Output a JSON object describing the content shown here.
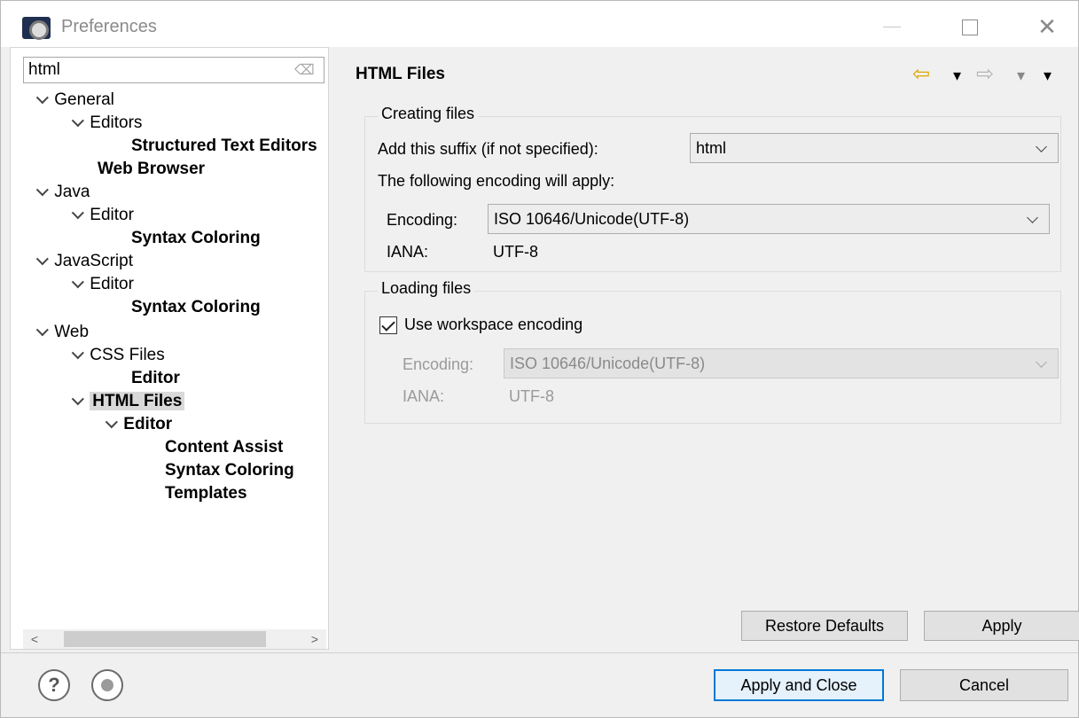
{
  "window": {
    "title": "Preferences",
    "close_glyph": "✕"
  },
  "sidebar": {
    "filter_value": "html",
    "items": [
      {
        "label": "General",
        "level": 0,
        "expanded": true,
        "bold": false
      },
      {
        "label": "Editors",
        "level": 1,
        "expanded": true,
        "bold": false
      },
      {
        "label": "Structured Text Editors",
        "level": 2,
        "expanded": false,
        "bold": true
      },
      {
        "label": "Web Browser",
        "level": 1,
        "expanded": false,
        "bold": true
      },
      {
        "label": "Java",
        "level": 0,
        "expanded": true,
        "bold": false
      },
      {
        "label": "Editor",
        "level": 1,
        "expanded": true,
        "bold": false
      },
      {
        "label": "Syntax Coloring",
        "level": 2,
        "expanded": false,
        "bold": true
      },
      {
        "label": "JavaScript",
        "level": 0,
        "expanded": true,
        "bold": false
      },
      {
        "label": "Editor",
        "level": 1,
        "expanded": true,
        "bold": false
      },
      {
        "label": "Syntax Coloring",
        "level": 2,
        "expanded": false,
        "bold": true
      },
      {
        "label": "Web",
        "level": 0,
        "expanded": true,
        "bold": false
      },
      {
        "label": "CSS Files",
        "level": 1,
        "expanded": true,
        "bold": false
      },
      {
        "label": "Editor",
        "level": 2,
        "expanded": false,
        "bold": true
      },
      {
        "label": "HTML Files",
        "level": 1,
        "expanded": true,
        "bold": true,
        "selected": true
      },
      {
        "label": "Editor",
        "level": 2,
        "expanded": true,
        "bold": true
      },
      {
        "label": "Content Assist",
        "level": 3,
        "expanded": false,
        "bold": true
      },
      {
        "label": "Syntax Coloring",
        "level": 3,
        "expanded": false,
        "bold": true
      },
      {
        "label": "Templates",
        "level": 3,
        "expanded": false,
        "bold": true
      }
    ],
    "scroll_left": "<",
    "scroll_right": ">"
  },
  "page": {
    "title": "HTML Files",
    "creating": {
      "group_title": "Creating files",
      "suffix_label": "Add this suffix (if not specified):",
      "suffix_value": "html",
      "encoding_apply_label": "The following encoding will apply:",
      "encoding_label": "Encoding:",
      "encoding_value": "ISO 10646/Unicode(UTF-8)",
      "iana_label": "IANA:",
      "iana_value": "UTF-8"
    },
    "loading": {
      "group_title": "Loading files",
      "use_workspace_label": "Use workspace encoding",
      "use_workspace_checked": true,
      "encoding_label": "Encoding:",
      "encoding_value": "ISO 10646/Unicode(UTF-8)",
      "iana_label": "IANA:",
      "iana_value": "UTF-8"
    },
    "restore_defaults_label": "Restore Defaults",
    "apply_label": "Apply"
  },
  "footer": {
    "help_glyph": "?",
    "apply_close_label": "Apply and Close",
    "cancel_label": "Cancel"
  },
  "colors": {
    "primary_border": "#0078d7",
    "back_arrow": "#e0a800"
  }
}
